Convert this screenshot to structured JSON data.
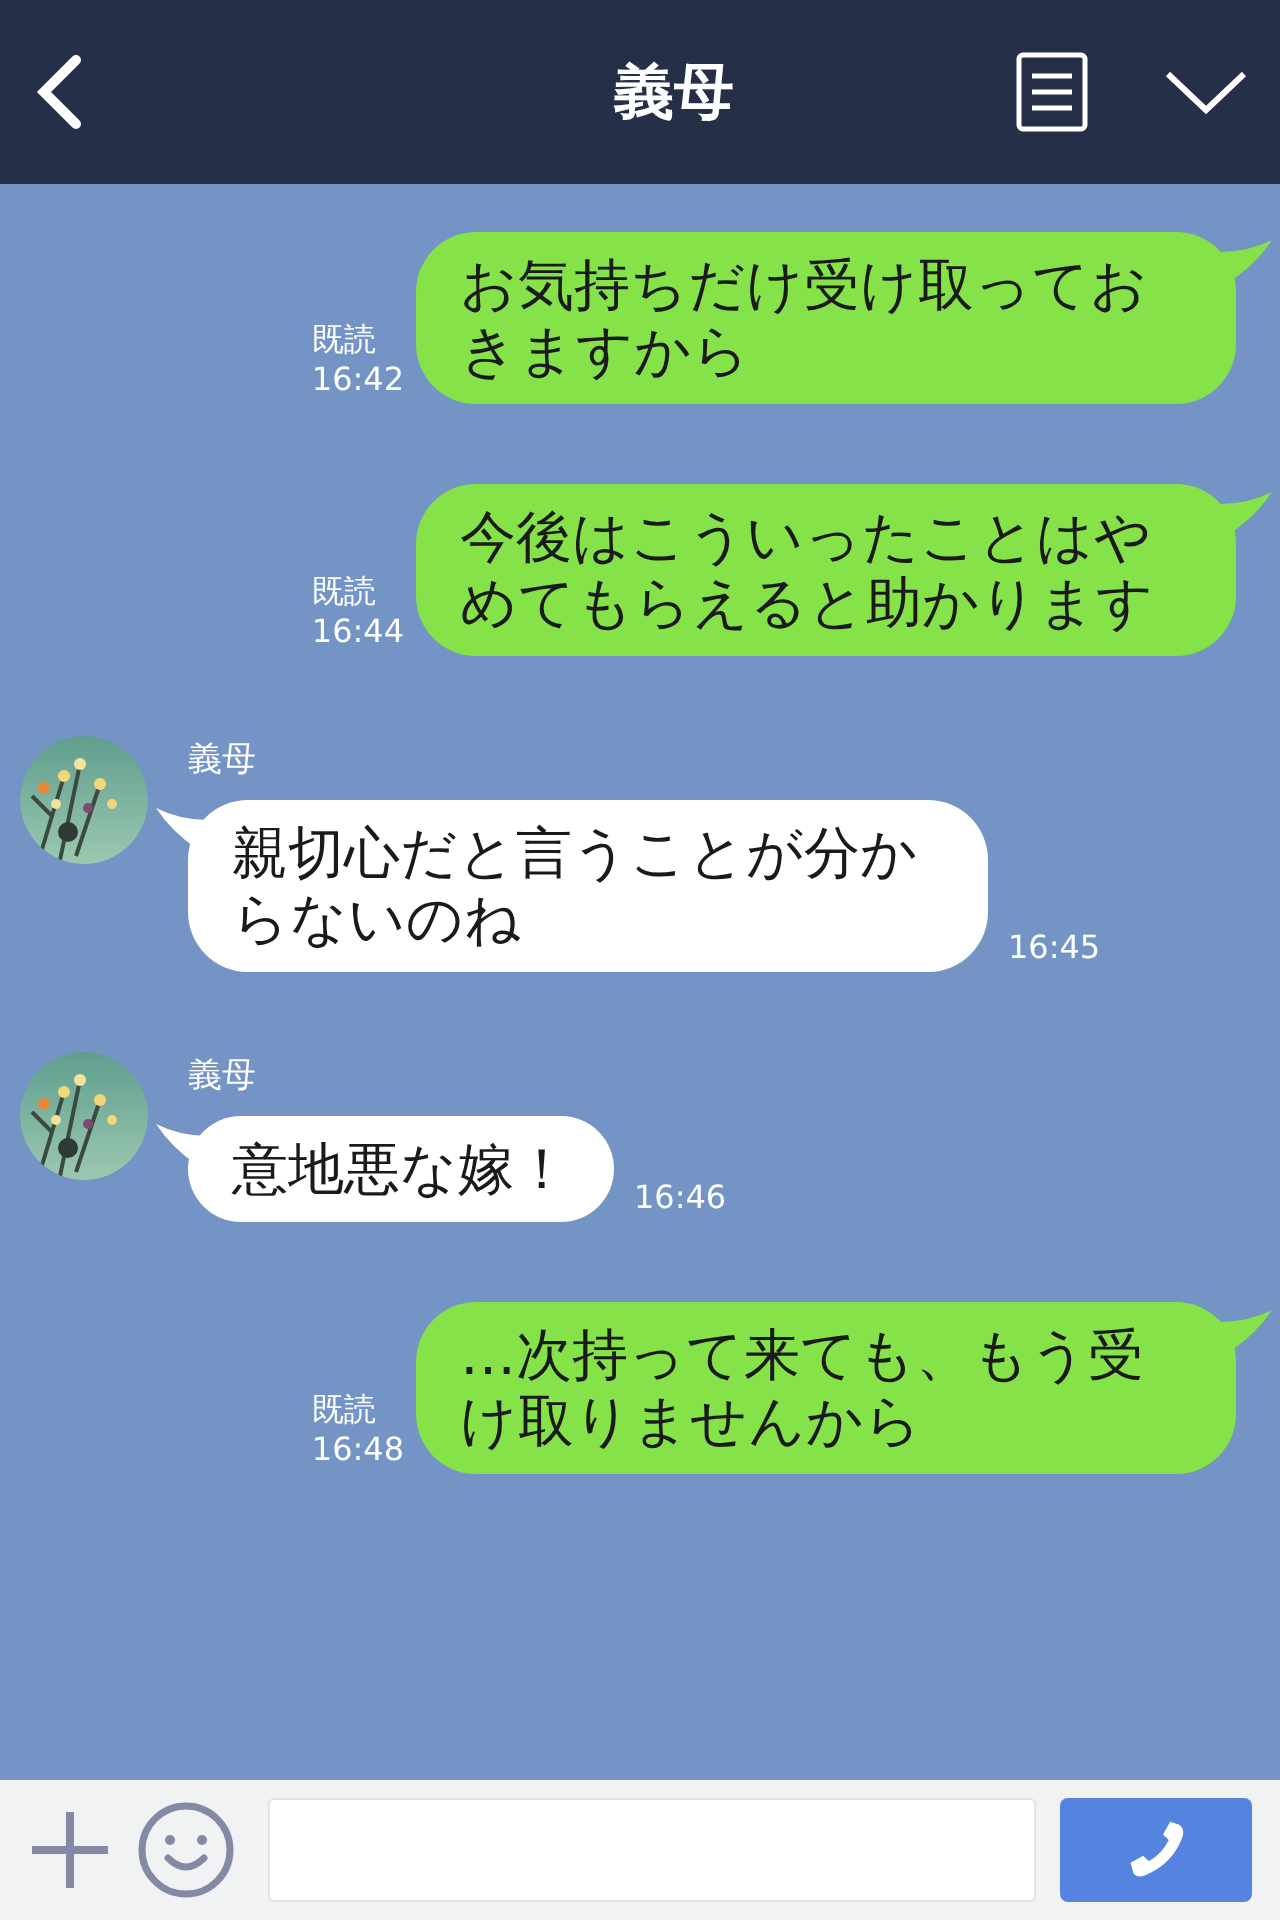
{
  "header": {
    "title": "義母"
  },
  "messages": [
    {
      "kind": "sent",
      "text": "お気持ちだけ受け取っておきますから",
      "read": "既読",
      "time": "16:42"
    },
    {
      "kind": "sent",
      "text": "今後はこういったことはやめてもらえると助かります",
      "read": "既読",
      "time": "16:44"
    },
    {
      "kind": "received",
      "sender": "義母",
      "text": "親切心だと言うことが分からないのね",
      "time": "16:45"
    },
    {
      "kind": "received",
      "sender": "義母",
      "text": "意地悪な嫁！",
      "time": "16:46"
    },
    {
      "kind": "sent",
      "text": "…次持って来ても、もう受け取りませんから",
      "read": "既読",
      "time": "16:48"
    }
  ]
}
